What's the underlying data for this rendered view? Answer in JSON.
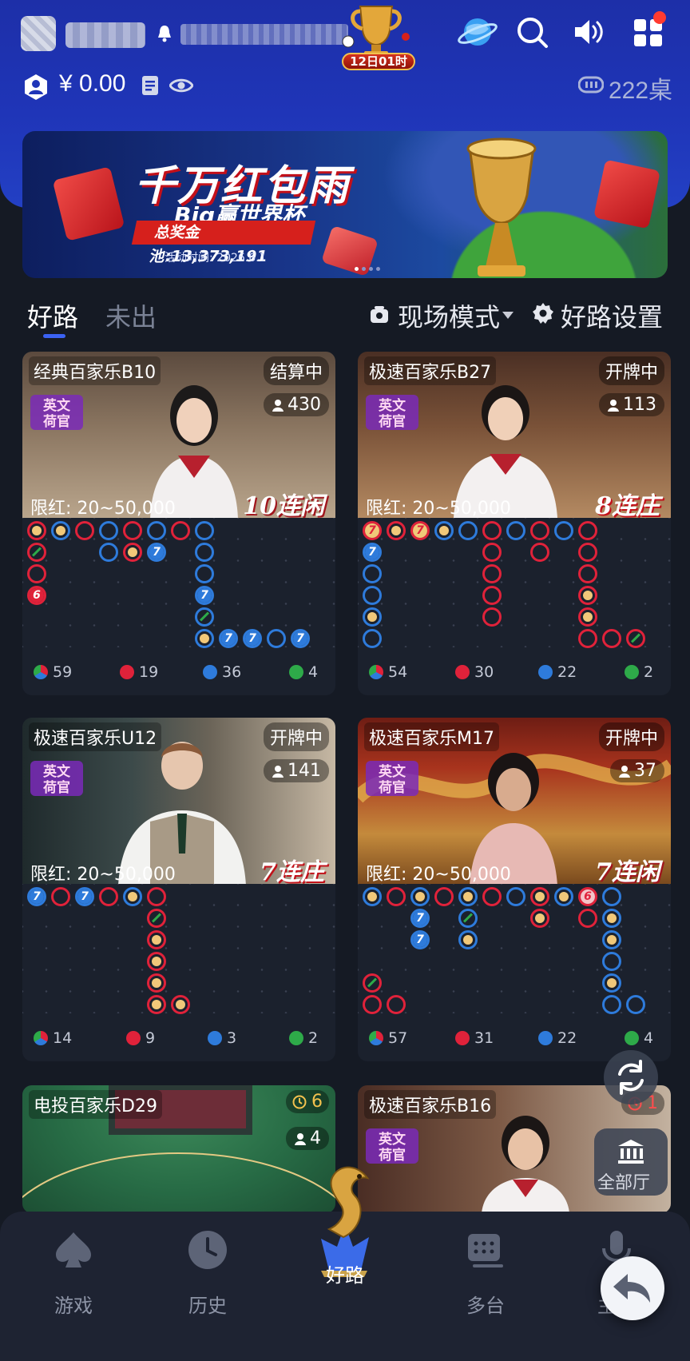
{
  "header": {
    "balance": "¥ 0.00",
    "trophy_badge": "12日01时",
    "tables_count": "222桌"
  },
  "banner": {
    "title": "千万红包雨",
    "subtitle": "Big赢世界杯",
    "prize_pool": "总奖金池:13,373,191",
    "activity_time": "活动时间: 2026.6.1"
  },
  "tabs": {
    "good_road": "好路",
    "unopened": "未出",
    "live_mode": "现场模式",
    "road_settings": "好路设置"
  },
  "tables": [
    {
      "name": "经典百家乐B10",
      "status": "结算中",
      "players": "430",
      "limit": "限红:  20~50,000",
      "streak": "10连闲",
      "stats": {
        "total": "59",
        "banker": "19",
        "player": "36",
        "tie": "4"
      }
    },
    {
      "name": "极速百家乐B27",
      "status": "开牌中",
      "players": "113",
      "limit": "限红:  20~50,000",
      "streak": "8连庄",
      "stats": {
        "total": "54",
        "banker": "30",
        "player": "22",
        "tie": "2"
      }
    },
    {
      "name": "极速百家乐U12",
      "status": "开牌中",
      "players": "141",
      "limit": "限红:  20~50,000",
      "streak": "7连庄",
      "stats": {
        "total": "14",
        "banker": "9",
        "player": "3",
        "tie": "2"
      }
    },
    {
      "name": "极速百家乐M17",
      "status": "开牌中",
      "players": "37",
      "limit": "限红:  20~50,000",
      "streak": "7连闲",
      "stats": {
        "total": "57",
        "banker": "31",
        "player": "22",
        "tie": "4"
      }
    },
    {
      "name": "电投百家乐D29",
      "countdown": "6",
      "players": "4"
    },
    {
      "name": "极速百家乐B16",
      "countdown": "1"
    }
  ],
  "english_dealer_badge": "英文荷官",
  "fab": {
    "all_halls": "全部厅"
  },
  "nav": [
    {
      "label": "游戏",
      "icon": "spade-icon"
    },
    {
      "label": "历史",
      "icon": "clock-icon"
    },
    {
      "label": "好路",
      "icon": "dragon-icon",
      "active": true
    },
    {
      "label": "多台",
      "icon": "multi-table-icon"
    },
    {
      "label": "主播",
      "icon": "microphone-icon"
    }
  ],
  "colors": {
    "banker": "#e0223a",
    "player": "#2e7bdb",
    "tie": "#2eaa49",
    "accent": "#3b62f3",
    "header_bg": "#1f35b8"
  }
}
